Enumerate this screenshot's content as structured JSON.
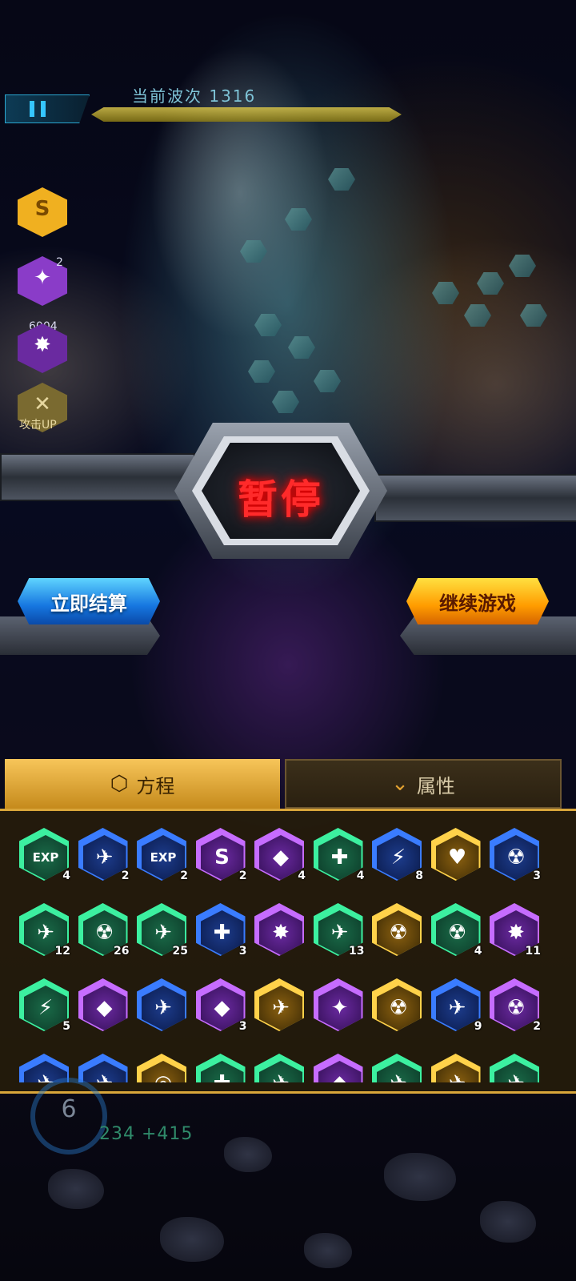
{
  "hud": {
    "wave_label": "当前波次 1316"
  },
  "side_items": [
    {
      "icon": "s-chip-icon",
      "glyph": "S",
      "color": "#f0b020",
      "count": ""
    },
    {
      "icon": "fighter-icon",
      "glyph": "✦",
      "color": "#8a3cc8",
      "count": "2"
    },
    {
      "icon": "burst-icon",
      "glyph": "✸",
      "color": "#6a2aa0",
      "count": "6004"
    },
    {
      "icon": "swords-icon",
      "glyph": "✕",
      "color": "#7a6a30",
      "count": "",
      "label": "攻击UP"
    }
  ],
  "pause": {
    "title": "暂停",
    "settle_label": "立即结算",
    "continue_label": "继续游戏"
  },
  "tabs": {
    "formula_label": "方程",
    "attribute_label": "属性"
  },
  "skills": [
    [
      {
        "color": "green",
        "glyph": "EXP",
        "count": "4"
      },
      {
        "color": "blue",
        "glyph": "✈",
        "count": "2"
      },
      {
        "color": "blue",
        "glyph": "EXP",
        "count": "2"
      },
      {
        "color": "purple",
        "glyph": "S",
        "count": "2"
      },
      {
        "color": "purple",
        "glyph": "◆",
        "count": "4"
      },
      {
        "color": "green",
        "glyph": "✚",
        "count": "4"
      },
      {
        "color": "blue",
        "glyph": "⚡",
        "count": "8"
      },
      {
        "color": "gold",
        "glyph": "♥",
        "count": ""
      },
      {
        "color": "blue",
        "glyph": "☢",
        "count": "3"
      }
    ],
    [
      {
        "color": "green",
        "glyph": "✈",
        "count": "12"
      },
      {
        "color": "green",
        "glyph": "☢",
        "count": "26"
      },
      {
        "color": "green",
        "glyph": "✈",
        "count": "25"
      },
      {
        "color": "blue",
        "glyph": "✚",
        "count": "3"
      },
      {
        "color": "purple",
        "glyph": "✸",
        "count": ""
      },
      {
        "color": "green",
        "glyph": "✈",
        "count": "13"
      },
      {
        "color": "gold",
        "glyph": "☢",
        "count": ""
      },
      {
        "color": "green",
        "glyph": "☢",
        "count": "4"
      },
      {
        "color": "purple",
        "glyph": "✸",
        "count": "11"
      }
    ],
    [
      {
        "color": "green",
        "glyph": "⚡",
        "count": "5"
      },
      {
        "color": "purple",
        "glyph": "◆",
        "count": ""
      },
      {
        "color": "blue",
        "glyph": "✈",
        "count": ""
      },
      {
        "color": "purple",
        "glyph": "◆",
        "count": "3"
      },
      {
        "color": "gold",
        "glyph": "✈",
        "count": ""
      },
      {
        "color": "purple",
        "glyph": "✦",
        "count": ""
      },
      {
        "color": "gold",
        "glyph": "☢",
        "count": ""
      },
      {
        "color": "blue",
        "glyph": "✈",
        "count": "9"
      },
      {
        "color": "purple",
        "glyph": "☢",
        "count": "2"
      }
    ],
    [
      {
        "color": "blue",
        "glyph": "✈",
        "count": ""
      },
      {
        "color": "blue",
        "glyph": "✈",
        "count": ""
      },
      {
        "color": "gold",
        "glyph": "◎",
        "count": ""
      },
      {
        "color": "green",
        "glyph": "✚",
        "count": ""
      },
      {
        "color": "green",
        "glyph": "✈",
        "count": ""
      },
      {
        "color": "purple",
        "glyph": "◆",
        "count": ""
      },
      {
        "color": "green",
        "glyph": "✈",
        "count": ""
      },
      {
        "color": "gold",
        "glyph": "✈",
        "count": ""
      },
      {
        "color": "green",
        "glyph": "✈",
        "count": ""
      }
    ]
  ],
  "footer": {
    "level": "6",
    "score": "234 +415"
  },
  "colors": {
    "accent_gold": "#d9a63a",
    "pause_red": "#ff2a2a",
    "settle_blue": "#1676e0",
    "continue_orange": "#ff9c00"
  }
}
